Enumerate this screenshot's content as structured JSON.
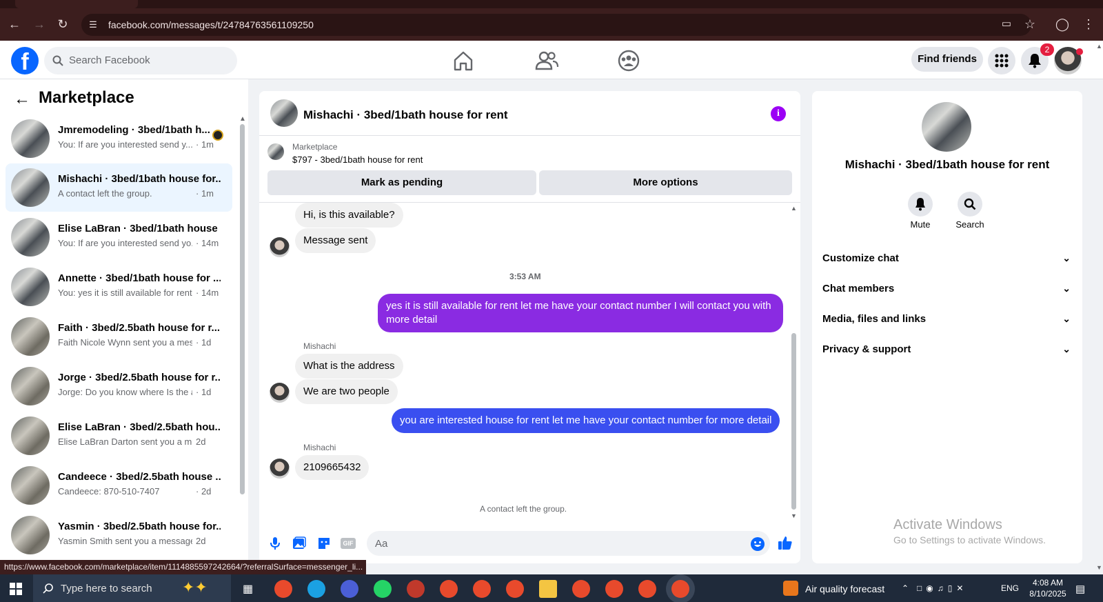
{
  "browser": {
    "url": "facebook.com/messages/t/24784763561109250",
    "status_url": "https://www.facebook.com/marketplace/item/1114885597242664/?referralSurface=messenger_li..."
  },
  "header": {
    "search_placeholder": "Search Facebook",
    "find_friends": "Find friends",
    "notification_count": "2",
    "brand_color": "#0866ff"
  },
  "sidebar": {
    "title": "Marketplace",
    "conversations": [
      {
        "name": "Jmremodeling · 3bed/1bath h...",
        "preview": "You: If are you interested send y...",
        "time": "· 1m"
      },
      {
        "name": "Mishachi · 3bed/1bath house for...",
        "preview": "A contact left the group.",
        "time": "· 1m"
      },
      {
        "name": "Elise LaBran · 3bed/1bath house ...",
        "preview": "You: If are you interested send yo...",
        "time": "· 14m"
      },
      {
        "name": "Annette · 3bed/1bath house for ...",
        "preview": "You: yes it is still available for rent...",
        "time": "· 14m"
      },
      {
        "name": "Faith · 3bed/2.5bath house for r...",
        "preview": "Faith Nicole Wynn sent you a mess...",
        "time": "· 1d"
      },
      {
        "name": "Jorge · 3bed/2.5bath house for r...",
        "preview": "Jorge: Do you know where Is the a...",
        "time": "· 1d"
      },
      {
        "name": "Elise LaBran · 3bed/2.5bath hou...",
        "preview": "Elise LaBran Darton sent you a mes...",
        "time": "2d"
      },
      {
        "name": "Candeece · 3bed/2.5bath house ...",
        "preview": "Candeece: 870-510-7407",
        "time": "· 2d"
      },
      {
        "name": "Yasmin · 3bed/2.5bath house for...",
        "preview": "Yasmin Smith sent you a message a...",
        "time": "2d"
      }
    ]
  },
  "chat": {
    "title": "Mishachi · 3bed/1bath house for rent",
    "marketplace_label": "Marketplace",
    "item": "$797 - 3bed/1bath house for rent",
    "mark_pending": "Mark as pending",
    "more_options": "More options",
    "messages": [
      {
        "text": "Hi, is this available?"
      },
      {
        "text": "Message sent"
      },
      {
        "text": "yes it is still available for rent let me have your contact number I will contact you with more detail"
      },
      {
        "sender": "Mishachi",
        "text": "What is the address"
      },
      {
        "text": "We are two people"
      },
      {
        "text": "you are interested house for rent let me have your contact number for more detail"
      },
      {
        "sender": "Mishachi",
        "text": "2109665432"
      }
    ],
    "timestamp": "3:53 AM",
    "notice": "A contact left the group.",
    "composer_placeholder": "Aa",
    "outgoing_color_1": "#8a2be2",
    "outgoing_color_2": "#3a4ff0"
  },
  "details": {
    "name": "Mishachi · 3bed/1bath house for rent",
    "mute": "Mute",
    "search": "Search",
    "sections": [
      "Customize chat",
      "Chat members",
      "Media, files and links",
      "Privacy & support"
    ],
    "watermark_title": "Activate Windows",
    "watermark_sub": "Go to Settings to activate Windows."
  },
  "taskbar": {
    "search_placeholder": "Type here to search",
    "weather": "Air quality forecast",
    "language": "ENG",
    "time": "4:08 AM",
    "date": "8/10/2025"
  }
}
